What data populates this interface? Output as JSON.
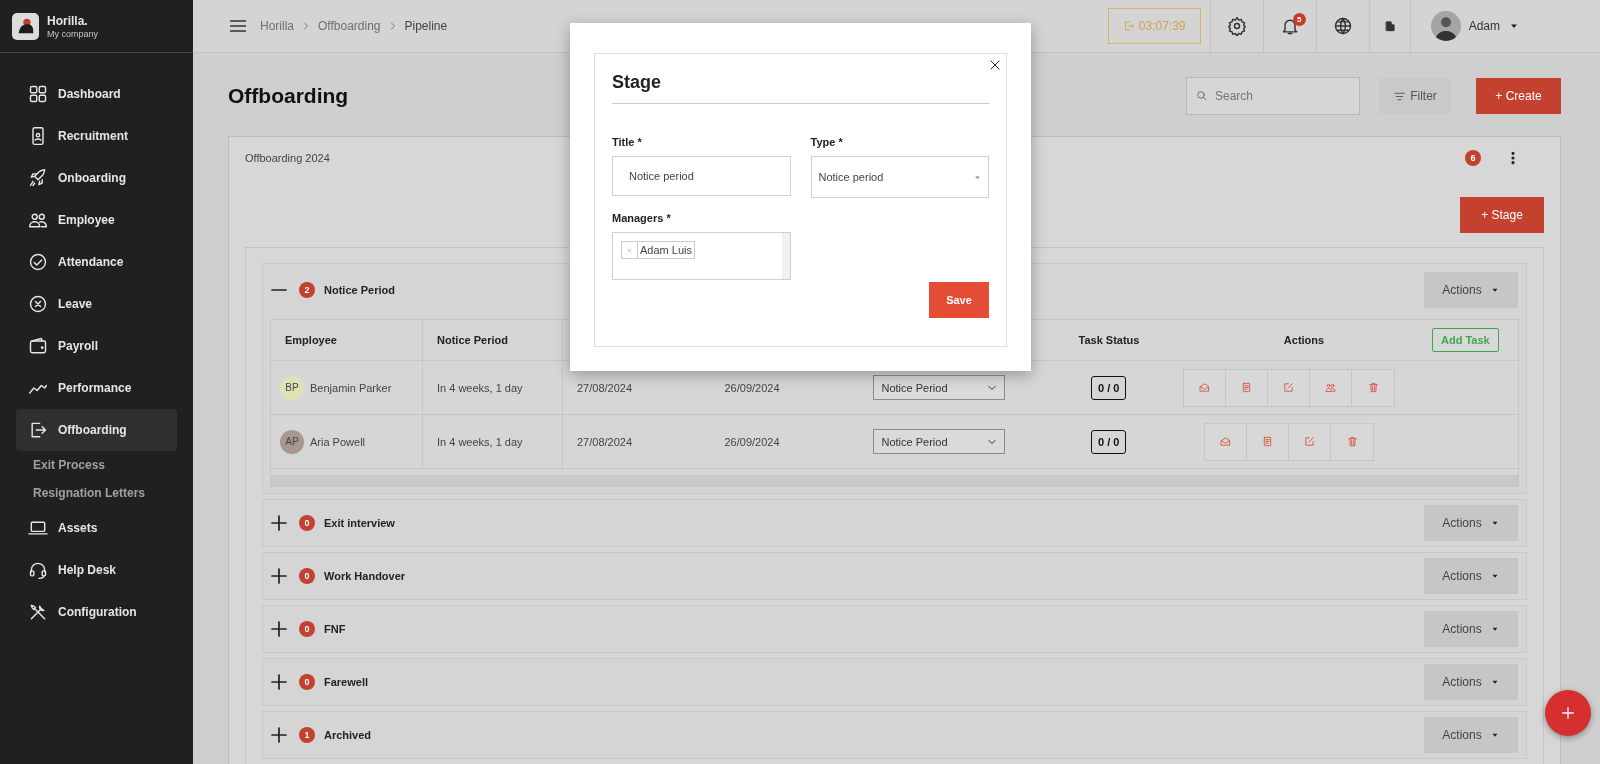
{
  "sidebar": {
    "brand": "Horilla.",
    "company": "My company",
    "items": [
      {
        "label": "Dashboard",
        "selected": false
      },
      {
        "label": "Recruitment",
        "selected": false
      },
      {
        "label": "Onboarding",
        "selected": false
      },
      {
        "label": "Employee",
        "selected": false
      },
      {
        "label": "Attendance",
        "selected": false
      },
      {
        "label": "Leave",
        "selected": false
      },
      {
        "label": "Payroll",
        "selected": false
      },
      {
        "label": "Performance",
        "selected": false
      },
      {
        "label": "Offboarding",
        "selected": true,
        "children": [
          {
            "label": "Exit Process"
          },
          {
            "label": "Resignation Letters"
          }
        ]
      },
      {
        "label": "Assets",
        "selected": false
      },
      {
        "label": "Help Desk",
        "selected": false
      },
      {
        "label": "Configuration",
        "selected": false
      }
    ]
  },
  "topbar": {
    "breadcrumb": [
      "Horilla",
      "Offboarding",
      "Pipeline"
    ],
    "timer": "03:07:39",
    "notifications": "5",
    "user": "Adam"
  },
  "page": {
    "title": "Offboarding",
    "search": {
      "placeholder": "Search"
    },
    "filter": "Filter",
    "create": "+ Create"
  },
  "pipeline": {
    "title": "Offboarding 2024",
    "count": "6",
    "add_stage": "+ Stage",
    "stages": [
      {
        "name": "Notice Period",
        "count": "2",
        "expanded": true,
        "actions": "Actions",
        "table": {
          "columns": [
            "Employee",
            "Notice Period",
            null,
            null,
            null,
            "Task Status",
            "Actions"
          ],
          "add_task": "Add Task",
          "rows": [
            {
              "initials": "BP",
              "color": "#dfe3b3",
              "name": "Benjamin Parker",
              "notice": "In 4 weeks, 1 day",
              "start": "27/08/2024",
              "end": "26/09/2024",
              "stage": "Notice Period",
              "tasks": "0 / 0",
              "actions": [
                {
                  "kind": "mail"
                },
                {
                  "kind": "document"
                },
                {
                  "kind": "edit"
                },
                {
                  "kind": "people"
                },
                {
                  "kind": "delete"
                }
              ]
            },
            {
              "initials": "AP",
              "color": "#a8968f",
              "name": "Aria Powell",
              "notice": "In 4 weeks, 1 day",
              "start": "27/08/2024",
              "end": "26/09/2024",
              "stage": "Notice Period",
              "tasks": "0 / 0",
              "actions": [
                {
                  "kind": "mail"
                },
                {
                  "kind": "document"
                },
                {
                  "kind": "edit"
                },
                {
                  "kind": "delete"
                }
              ]
            }
          ]
        }
      },
      {
        "name": "Exit interview",
        "count": "0",
        "expanded": false,
        "actions": "Actions"
      },
      {
        "name": "Work Handover",
        "count": "0",
        "expanded": false,
        "actions": "Actions"
      },
      {
        "name": "FNF",
        "count": "0",
        "expanded": false,
        "actions": "Actions"
      },
      {
        "name": "Farewell",
        "count": "0",
        "expanded": false,
        "actions": "Actions"
      },
      {
        "name": "Archived",
        "count": "1",
        "expanded": false,
        "actions": "Actions"
      }
    ]
  },
  "modal": {
    "title": "Stage",
    "fields": [
      {
        "kind": "text",
        "label": "Title *",
        "value": "Notice period"
      },
      {
        "kind": "select",
        "label": "Type *",
        "value": "Notice period"
      },
      {
        "kind": "tags",
        "label": "Managers *",
        "tags": [
          "Adam Luis"
        ]
      }
    ],
    "save": "Save"
  }
}
